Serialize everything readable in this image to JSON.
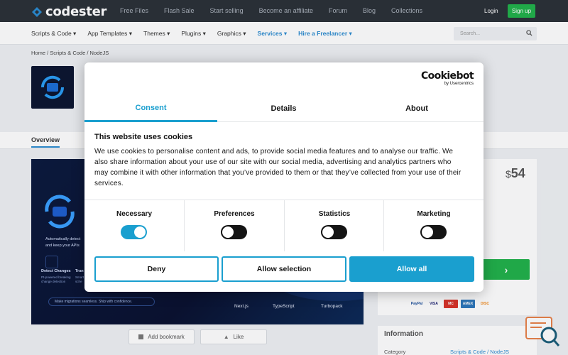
{
  "header": {
    "brand": "codester",
    "nav": [
      "Free Files",
      "Flash Sale",
      "Start selling",
      "Become an affiliate",
      "Forum",
      "Blog",
      "Collections"
    ],
    "login": "Login",
    "signup": "Sign up"
  },
  "subnav": {
    "items": [
      "Scripts & Code ▾",
      "App Templates ▾",
      "Themes ▾",
      "Plugins ▾",
      "Graphics ▾",
      "Services ▾",
      "Hire a Freelancer ▾"
    ],
    "search_placeholder": "Search..."
  },
  "breadcrumb": "Home / Scripts & Code / NodeJS",
  "page": {
    "overview_tab": "Overview",
    "banner": {
      "tagline_1": "Automatically detect",
      "tagline_2": "and keep your APIs",
      "feature_1": "Detect Changes",
      "feature_1_sub": "Pt-powered breaking",
      "feature_1_sub2": "change detection",
      "feature_2": "Tran",
      "feature_2_sub": "Smart",
      "feature_2_sub2": "sche",
      "chip": "Make migrations seamless. Ship with confidence.",
      "tech": [
        "Next.js",
        "TypeScript",
        "Turbopack"
      ]
    },
    "add_bookmark": "Add bookmark",
    "like": "Like",
    "price_currency": "$",
    "price": "54",
    "payment_cards": [
      "PayPal",
      "VISA",
      "MC",
      "AMEX",
      "DISC"
    ],
    "info_heading": "Information",
    "info_category_label": "Category",
    "info_category_value": "Scripts & Code / NodeJS"
  },
  "cookie_dialog": {
    "brand": "Cookiebot",
    "brand_sub": "by Usercentrics",
    "tabs": [
      "Consent",
      "Details",
      "About"
    ],
    "active_tab": "Consent",
    "heading": "This website uses cookies",
    "body": "We use cookies to personalise content and ads, to provide social media features and to analyse our traffic. We also share information about your use of our site with our social media, advertising and analytics partners who may combine it with other information that you’ve provided to them or that they’ve collected from your use of their services.",
    "toggles": [
      {
        "label": "Necessary",
        "on": true
      },
      {
        "label": "Preferences",
        "on": false
      },
      {
        "label": "Statistics",
        "on": false
      },
      {
        "label": "Marketing",
        "on": false
      }
    ],
    "buttons": {
      "deny": "Deny",
      "allow_selection": "Allow selection",
      "allow_all": "Allow all"
    },
    "accent": "#1a9fcf"
  }
}
